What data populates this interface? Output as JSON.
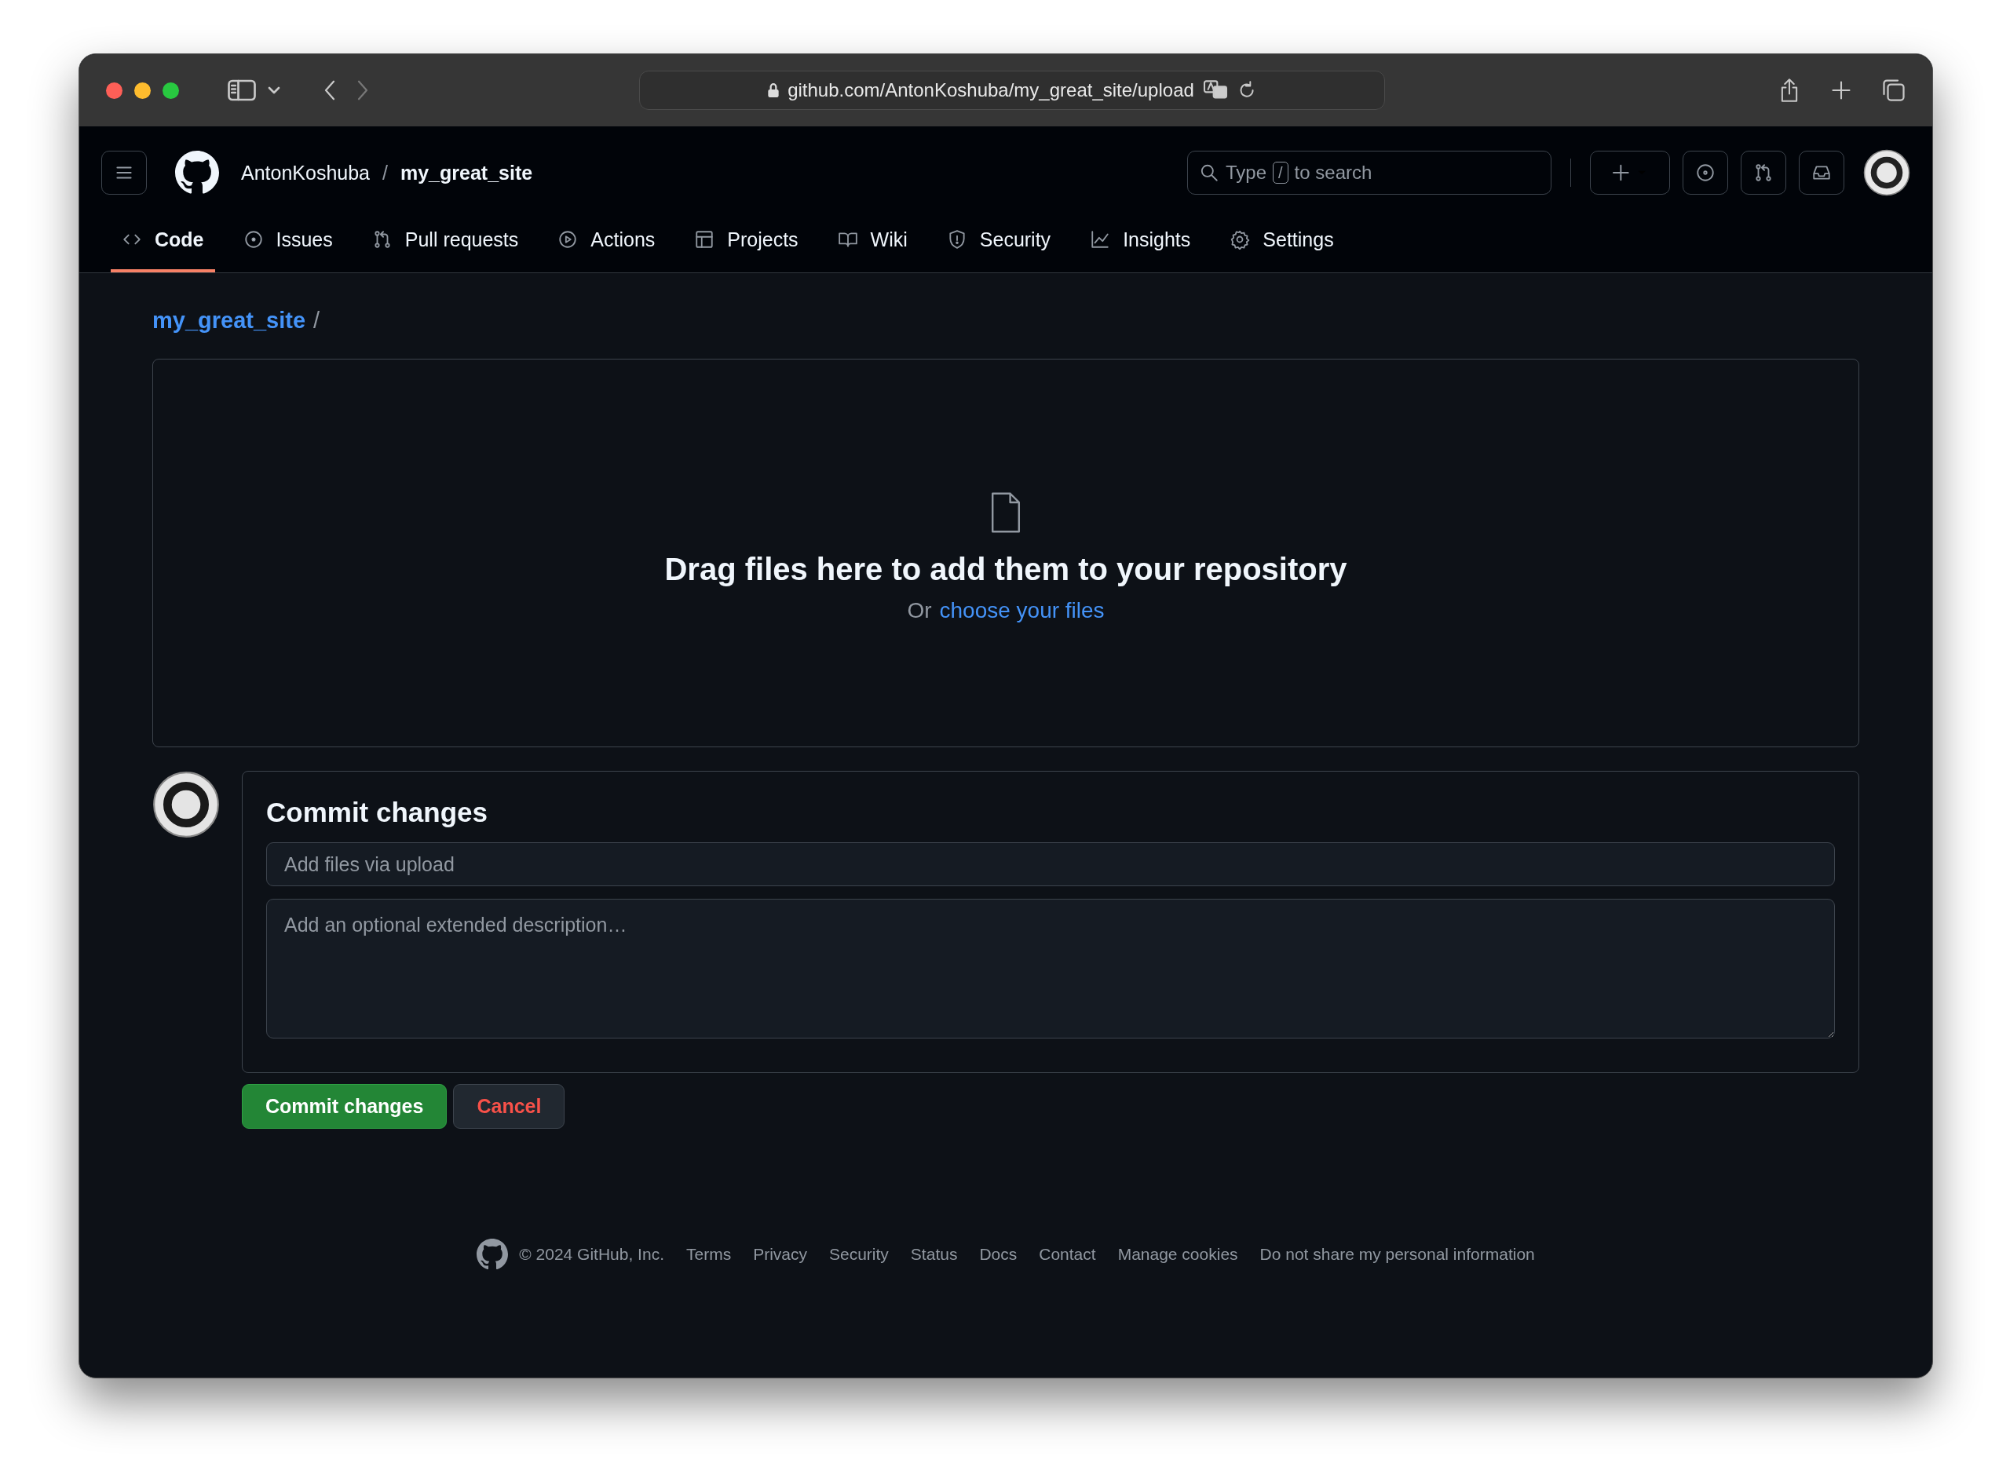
{
  "browser": {
    "url": "github.com/AntonKoshuba/my_great_site/upload"
  },
  "header": {
    "owner": "AntonKoshuba",
    "separator": "/",
    "repo": "my_great_site",
    "search": {
      "before": "Type",
      "key": "/",
      "after": "to search"
    }
  },
  "tabs": [
    {
      "label": "Code",
      "selected": true
    },
    {
      "label": "Issues",
      "selected": false
    },
    {
      "label": "Pull requests",
      "selected": false
    },
    {
      "label": "Actions",
      "selected": false
    },
    {
      "label": "Projects",
      "selected": false
    },
    {
      "label": "Wiki",
      "selected": false
    },
    {
      "label": "Security",
      "selected": false
    },
    {
      "label": "Insights",
      "selected": false
    },
    {
      "label": "Settings",
      "selected": false
    }
  ],
  "breadcrumb": {
    "repo": "my_great_site",
    "separator": "/"
  },
  "dropzone": {
    "title": "Drag files here to add them to your repository",
    "prefix": "Or",
    "link": "choose your files"
  },
  "commit": {
    "title": "Commit changes",
    "summary": {
      "placeholder": "Add files via upload"
    },
    "description": {
      "placeholder": "Add an optional extended description…"
    },
    "buttons": [
      {
        "label": "Commit changes",
        "kind": "primary"
      },
      {
        "label": "Cancel",
        "kind": "cancel"
      }
    ]
  },
  "footer": {
    "copyright": "© 2024 GitHub, Inc.",
    "links": [
      "Terms",
      "Privacy",
      "Security",
      "Status",
      "Docs",
      "Contact",
      "Manage cookies",
      "Do not share my personal information"
    ]
  }
}
